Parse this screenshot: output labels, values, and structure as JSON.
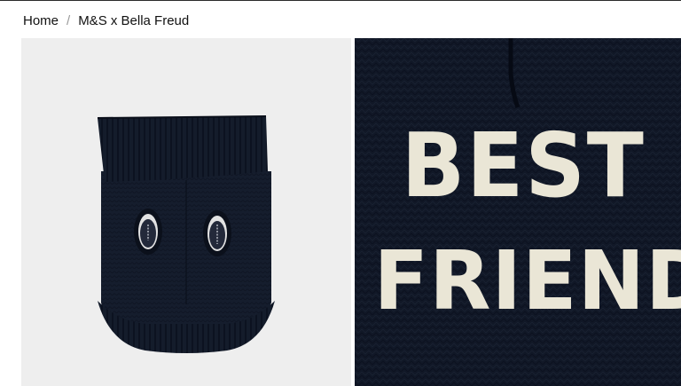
{
  "breadcrumb": {
    "home_label": "Home",
    "separator": "/",
    "current_label": "M&S x Bella Freud"
  },
  "product_images": {
    "left": {
      "name": "dog-jumper-full-view"
    },
    "right": {
      "name": "dog-jumper-detail",
      "knit_text_line1": "BEST",
      "knit_text_line2": "FRIEND"
    }
  },
  "colors": {
    "knit_navy": "#141c2b",
    "knit_cream": "#eae6d6",
    "background_grey": "#eeeeee"
  }
}
